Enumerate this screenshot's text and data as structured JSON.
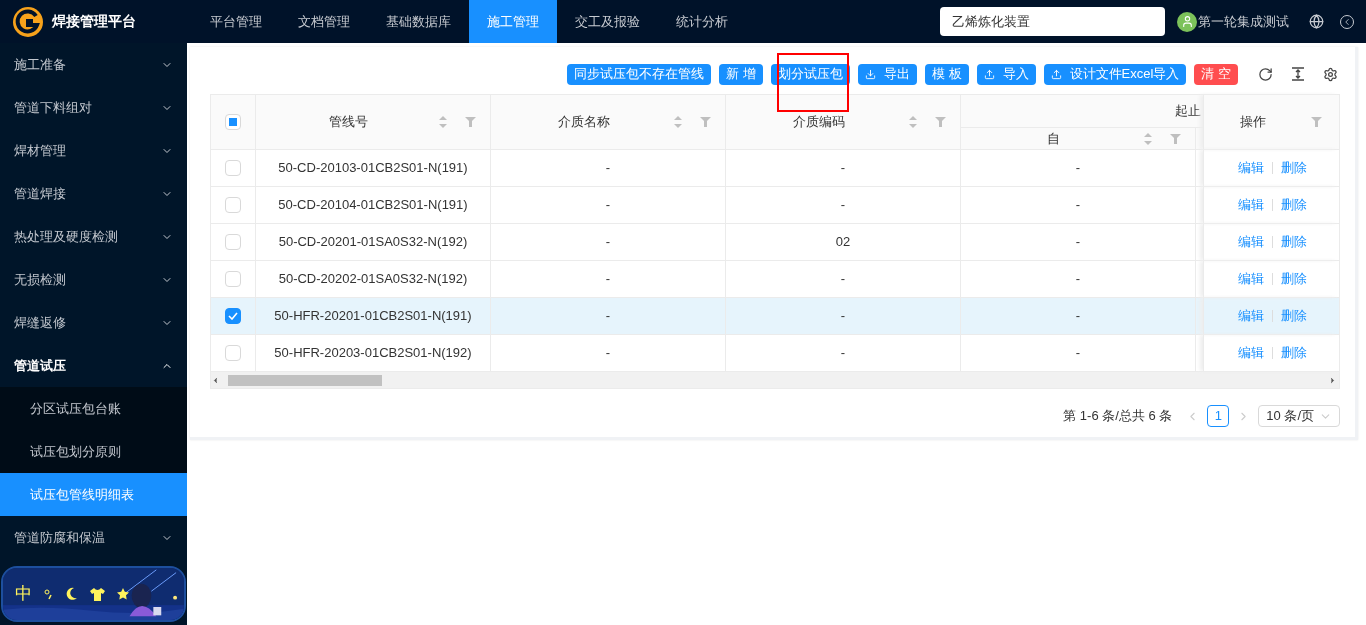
{
  "header": {
    "logo_text": "焊接管理平台",
    "nav": [
      {
        "label": "平台管理",
        "selected": false
      },
      {
        "label": "文档管理",
        "selected": false
      },
      {
        "label": "基础数据库",
        "selected": false
      },
      {
        "label": "施工管理",
        "selected": true
      },
      {
        "label": "交工及报验",
        "selected": false
      },
      {
        "label": "统计分析",
        "selected": false
      }
    ],
    "project_field": {
      "value": "乙烯炼化装置"
    },
    "user": "第一轮集成测试"
  },
  "sidebar": {
    "items": [
      {
        "label": "施工准备",
        "expanded": false
      },
      {
        "label": "管道下料组对",
        "expanded": false
      },
      {
        "label": "焊材管理",
        "expanded": false
      },
      {
        "label": "管道焊接",
        "expanded": false
      },
      {
        "label": "热处理及硬度检测",
        "expanded": false
      },
      {
        "label": "无损检测",
        "expanded": false
      },
      {
        "label": "焊缝返修",
        "expanded": false
      },
      {
        "label": "管道试压",
        "expanded": true,
        "children": [
          {
            "label": "分区试压包台账",
            "selected": false
          },
          {
            "label": "试压包划分原则",
            "selected": false
          },
          {
            "label": "试压包管线明细表",
            "selected": true
          }
        ]
      },
      {
        "label": "管道防腐和保温",
        "expanded": false
      }
    ],
    "widget": {
      "label": "中"
    }
  },
  "toolbar": {
    "buttons": [
      {
        "label": "同步试压包不存在管线",
        "kind": "primary",
        "highlighted": false
      },
      {
        "label": "新 增",
        "kind": "primary",
        "highlighted": false
      },
      {
        "label": "划分试压包",
        "kind": "primary",
        "highlighted": true
      },
      {
        "label": "导出",
        "kind": "download",
        "highlighted": false
      },
      {
        "label": "模 板",
        "kind": "primary",
        "highlighted": false
      },
      {
        "label": "导入",
        "kind": "upload",
        "highlighted": false
      },
      {
        "label": "设计文件Excel导入",
        "kind": "upload",
        "highlighted": false
      },
      {
        "label": "清 空",
        "kind": "danger",
        "highlighted": false
      }
    ]
  },
  "table": {
    "header_checkbox": {
      "indeterminate": true
    },
    "columns": [
      "管线号",
      "介质名称",
      "介质编码"
    ],
    "group": {
      "label": "起止",
      "sub": "自"
    },
    "action_column": "操作",
    "rows": [
      {
        "selected": false,
        "cells": [
          "50-CD-20103-01CB2S01-N(191)",
          "-",
          "-",
          "-"
        ],
        "actions": [
          "编辑",
          "删除"
        ]
      },
      {
        "selected": false,
        "cells": [
          "50-CD-20104-01CB2S01-N(191)",
          "-",
          "-",
          "-"
        ],
        "actions": [
          "编辑",
          "删除"
        ]
      },
      {
        "selected": false,
        "cells": [
          "50-CD-20201-01SA0S32-N(192)",
          "-",
          "02",
          "-"
        ],
        "actions": [
          "编辑",
          "删除"
        ]
      },
      {
        "selected": false,
        "cells": [
          "50-CD-20202-01SA0S32-N(192)",
          "-",
          "-",
          "-"
        ],
        "actions": [
          "编辑",
          "删除"
        ]
      },
      {
        "selected": true,
        "cells": [
          "50-HFR-20201-01CB2S01-N(191)",
          "-",
          "-",
          "-"
        ],
        "actions": [
          "编辑",
          "删除"
        ]
      },
      {
        "selected": false,
        "cells": [
          "50-HFR-20203-01CB2S01-N(192)",
          "-",
          "-",
          "-"
        ],
        "actions": [
          "编辑",
          "删除"
        ]
      }
    ]
  },
  "pagination": {
    "summary": "第 1-6 条/总共 6 条",
    "pages": [
      {
        "label": "1",
        "selected": true
      }
    ],
    "page_size": "10 条/页"
  }
}
